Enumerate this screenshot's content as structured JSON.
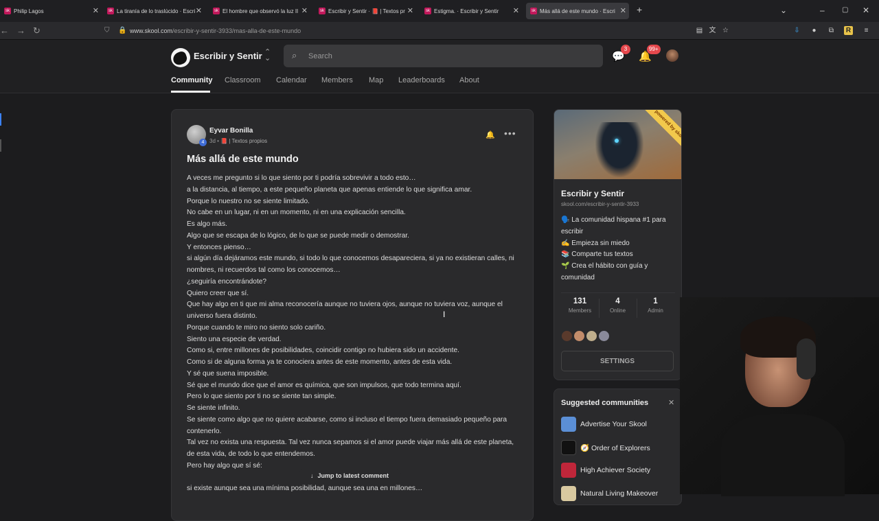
{
  "browser": {
    "tabs": [
      {
        "title": "Philip Lagos",
        "fav": "sk"
      },
      {
        "title": "La tiranía de lo traslúcido · Escri",
        "fav": "sk"
      },
      {
        "title": "El hombre que observó la luz II",
        "fav": "sk"
      },
      {
        "title": "Escribir y Sentir · 📕 | Textos pr",
        "fav": "sk"
      },
      {
        "title": "Estigma. · Escribir y Sentir",
        "fav": "sk"
      },
      {
        "title": "Más allá de este mundo · Escri",
        "fav": "sk",
        "active": true
      }
    ],
    "new_tab": "+",
    "url_host": "www.skool.com",
    "url_path": "/escribir-y-sentir-3933/mas-alla-de-este-mundo"
  },
  "header": {
    "group_name": "Escribir y Sentir",
    "search_placeholder": "Search",
    "chat_badge": "3",
    "notif_badge": "99+"
  },
  "nav": [
    "Community",
    "Classroom",
    "Calendar",
    "Members",
    "Map",
    "Leaderboards",
    "About"
  ],
  "post": {
    "author": "Eyvar Bonilla",
    "level": "4",
    "time": "3d",
    "category": "📕 | Textos propios",
    "title": "Más allá de este mundo",
    "body": [
      "A veces me pregunto si lo que siento por ti podría sobrevivir a todo esto…",
      "a la distancia, al tiempo, a este pequeño planeta que apenas entiende lo que significa amar.",
      "Porque lo nuestro no se siente limitado.",
      "No cabe en un lugar, ni en un momento, ni en una explicación sencilla.",
      "Es algo más.",
      "Algo que se escapa de lo lógico, de lo que se puede medir o demostrar.",
      "Y entonces pienso…",
      "si algún día dejáramos este mundo, si todo lo que conocemos desapareciera, si ya no existieran calles, ni nombres, ni recuerdos tal como los conocemos…",
      "¿seguiría encontrándote?",
      "Quiero creer que sí.",
      "Que hay algo en ti que mi alma reconocería aunque no tuviera ojos, aunque no tuviera voz, aunque el universo fuera distinto.",
      "Porque cuando te miro no siento solo cariño.",
      "Siento una especie de verdad.",
      "Como si, entre millones de posibilidades, coincidir contigo no hubiera sido un accidente.",
      "Como si de alguna forma ya te conociera antes de este momento, antes de esta vida.",
      "Y sé que suena imposible.",
      "Sé que el mundo dice que el amor es química, que son impulsos, que todo termina aquí.",
      "Pero lo que siento por ti no se siente tan simple.",
      "Se siente infinito.",
      "Se siente como algo que no quiere acabarse, como si incluso el tiempo fuera demasiado pequeño para contenerlo.",
      "Tal vez no exista una respuesta. Tal vez nunca sepamos si el amor puede viajar más allá de este planeta, de esta vida, de todo lo que entendemos.",
      "Pero hay algo que sí sé:",
      "",
      "si existe aunque sea una mínima posibilidad, aunque sea una en millones…"
    ],
    "jump_label": "Jump to latest comment"
  },
  "group": {
    "ribbon": "powered by skool",
    "name": "Escribir y Sentir",
    "url": "skool.com/escribir-y-sentir-3933",
    "desc": [
      "🗣️ La comunidad hispana #1 para escribir",
      "✍️ Empieza sin miedo",
      "📚 Comparte tus textos",
      "🌱 Crea el hábito con guía y comunidad"
    ],
    "stats": [
      {
        "value": "131",
        "label": "Members"
      },
      {
        "value": "4",
        "label": "Online"
      },
      {
        "value": "1",
        "label": "Admin"
      }
    ],
    "settings_label": "SETTINGS"
  },
  "suggested": {
    "title": "Suggested communities",
    "items": [
      {
        "name": "Advertise Your Skool",
        "color": "#5b8fd6"
      },
      {
        "name": "🧭 Order of Explorers",
        "color": "#111111"
      },
      {
        "name": "High Achiever Society",
        "color": "#c0263a"
      },
      {
        "name": "Natural Living Makeover",
        "color": "#d9c9a0"
      }
    ]
  }
}
